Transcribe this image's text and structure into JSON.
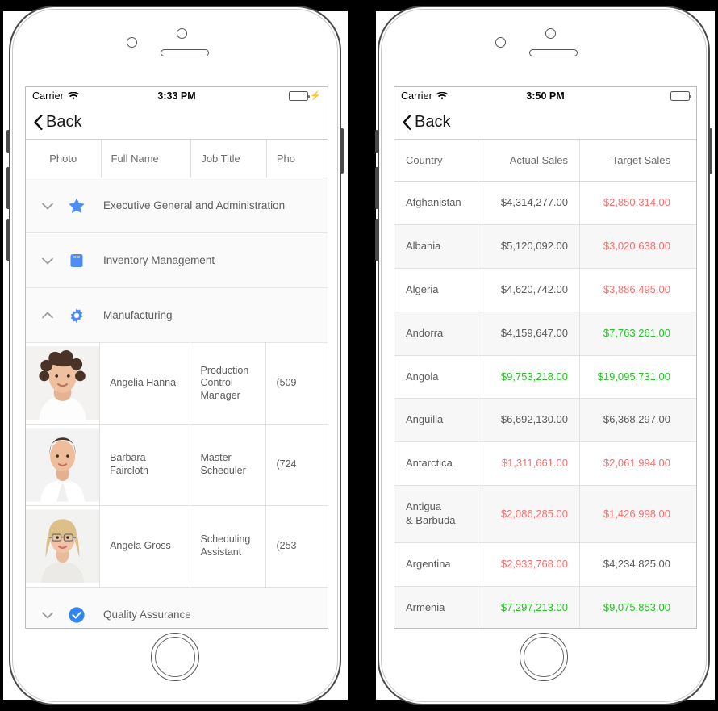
{
  "background_color": "#000000",
  "phones": {
    "left": {
      "name": "employee-directory-phone",
      "status_bar": {
        "carrier": "Carrier",
        "wifi_icon": "wifi-icon",
        "time": "3:33 PM",
        "battery_icon": "battery-icon",
        "battery_color": "#3ad13a",
        "battery_charging": true,
        "charging_icon": "lightning-bolt-icon"
      },
      "nav": {
        "back_label": "Back",
        "back_icon": "chevron-left-icon"
      },
      "grid": {
        "columns": [
          "Photo",
          "Full Name",
          "Job Title",
          "Pho"
        ],
        "groups": [
          {
            "label": "Executive General and Administration",
            "icon": "star-icon",
            "icon_color": "#4f8df5",
            "expanded": false,
            "chevron": "chevron-down-icon",
            "rows": []
          },
          {
            "label": "Inventory Management",
            "icon": "box-icon",
            "icon_color": "#4f8df5",
            "expanded": false,
            "chevron": "chevron-down-icon",
            "rows": []
          },
          {
            "label": "Manufacturing",
            "icon": "gear-icon",
            "icon_color": "#4f8df5",
            "expanded": true,
            "chevron": "chevron-up-icon",
            "rows": [
              {
                "photo": "woman-curly-hair-photo",
                "full_name": "Angelia Hanna",
                "job_title": "Production\nControl Manager",
                "phone": "(509"
              },
              {
                "photo": "woman-white-shirt-photo",
                "full_name": "Barbara\nFaircloth",
                "job_title": "Master\nScheduler",
                "phone": "(724"
              },
              {
                "photo": "woman-glasses-photo",
                "full_name": "Angela Gross",
                "job_title": "Scheduling\nAssistant",
                "phone": "(253"
              }
            ]
          },
          {
            "label": "Quality Assurance",
            "icon": "check-circle-icon",
            "icon_color": "#2f86f0",
            "expanded": false,
            "chevron": "chevron-down-icon",
            "rows": []
          }
        ]
      }
    },
    "right": {
      "name": "sales-by-country-phone",
      "status_bar": {
        "carrier": "Carrier",
        "wifi_icon": "wifi-icon",
        "time": "3:50 PM",
        "battery_icon": "battery-icon",
        "battery_color": "#000000",
        "battery_charging": false
      },
      "nav": {
        "back_label": "Back",
        "back_icon": "chevron-left-icon"
      },
      "grid": {
        "columns": [
          "Country",
          "Actual Sales",
          "Target Sales"
        ],
        "colors": {
          "high": "#22c522",
          "low": "#fa6e6e",
          "normal": "#5a5a5a"
        },
        "rows": [
          {
            "country": "Afghanistan",
            "actual": "$4,314,277.00",
            "actual_state": "normal",
            "target": "$2,850,314.00",
            "target_state": "low"
          },
          {
            "country": "Albania",
            "actual": "$5,120,092.00",
            "actual_state": "normal",
            "target": "$3,020,638.00",
            "target_state": "low"
          },
          {
            "country": "Algeria",
            "actual": "$4,620,742.00",
            "actual_state": "normal",
            "target": "$3,886,495.00",
            "target_state": "low"
          },
          {
            "country": "Andorra",
            "actual": "$4,159,647.00",
            "actual_state": "normal",
            "target": "$7,763,261.00",
            "target_state": "high"
          },
          {
            "country": "Angola",
            "actual": "$9,753,218.00",
            "actual_state": "high",
            "target": "$19,095,731.00",
            "target_state": "high"
          },
          {
            "country": "Anguilla",
            "actual": "$6,692,130.00",
            "actual_state": "normal",
            "target": "$6,368,297.00",
            "target_state": "normal"
          },
          {
            "country": "Antarctica",
            "actual": "$1,311,661.00",
            "actual_state": "low",
            "target": "$2,061,994.00",
            "target_state": "low"
          },
          {
            "country": "Antigua\n& Barbuda",
            "actual": "$2,086,285.00",
            "actual_state": "low",
            "target": "$1,426,998.00",
            "target_state": "low"
          },
          {
            "country": "Argentina",
            "actual": "$2,933,768.00",
            "actual_state": "low",
            "target": "$4,234,825.00",
            "target_state": "normal"
          },
          {
            "country": "Armenia",
            "actual": "$7,297,213.00",
            "actual_state": "high",
            "target": "$9,075,853.00",
            "target_state": "high"
          }
        ]
      }
    }
  }
}
